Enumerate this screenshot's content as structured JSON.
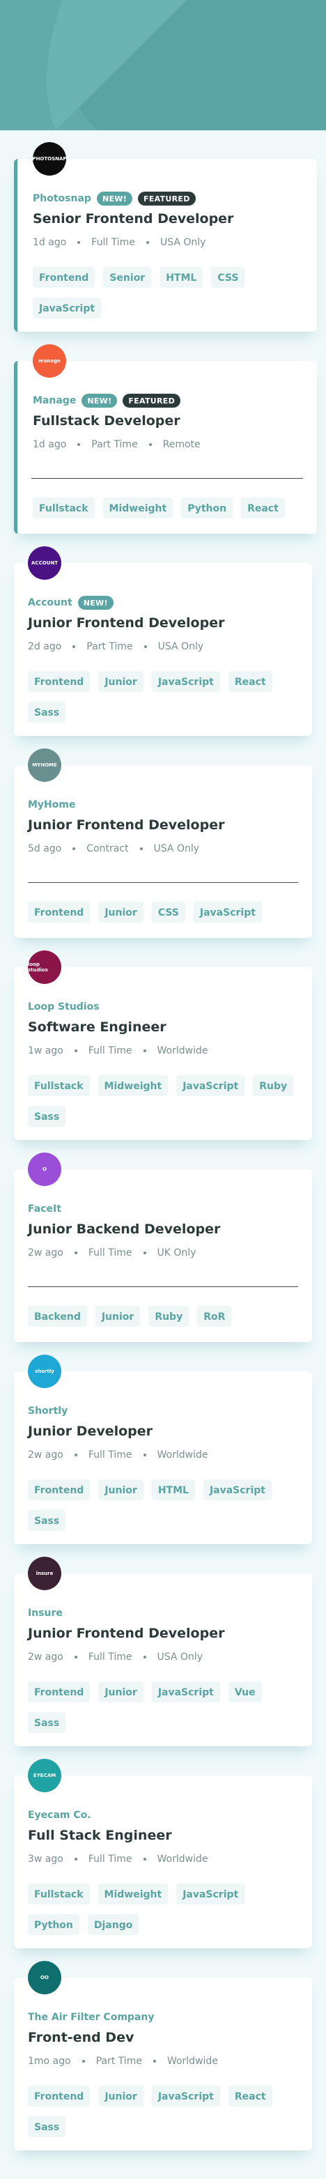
{
  "jobs": [
    {
      "company": "Photosnap",
      "logo_text": "PHOTOSNAP",
      "logo_color": "#0d0d0d",
      "new_badge": "NEW!",
      "featured_badge": "FEATURED",
      "title": "Senior Frontend Developer",
      "posted": "1d ago",
      "contract": "Full Time",
      "location": "USA Only",
      "tags": [
        "Frontend",
        "Senior",
        "HTML",
        "CSS",
        "JavaScript"
      ]
    },
    {
      "company": "Manage",
      "logo_text": "manage",
      "logo_color": "#f25f3a",
      "new_badge": "NEW!",
      "featured_badge": "FEATURED",
      "title": "Fullstack Developer",
      "posted": "1d ago",
      "contract": "Part Time",
      "location": "Remote",
      "tags": [
        "Fullstack",
        "Midweight",
        "Python",
        "React"
      ]
    },
    {
      "company": "Account",
      "logo_text": "ACCOUNT",
      "logo_color": "#4b1286",
      "new_badge": "NEW!",
      "title": "Junior Frontend Developer",
      "posted": "2d ago",
      "contract": "Part Time",
      "location": "USA Only",
      "tags": [
        "Frontend",
        "Junior",
        "JavaScript",
        "React",
        "Sass"
      ]
    },
    {
      "company": "MyHome",
      "logo_text": "MYHOME",
      "logo_color": "#6a8f8f",
      "title": "Junior Frontend Developer",
      "posted": "5d ago",
      "contract": "Contract",
      "location": "USA Only",
      "tags": [
        "Frontend",
        "Junior",
        "CSS",
        "JavaScript"
      ]
    },
    {
      "company": "Loop Studios",
      "logo_text": "loop studios",
      "logo_color": "#8b1448",
      "title": "Software Engineer",
      "posted": "1w ago",
      "contract": "Full Time",
      "location": "Worldwide",
      "tags": [
        "Fullstack",
        "Midweight",
        "JavaScript",
        "Ruby",
        "Sass"
      ]
    },
    {
      "company": "FaceIt",
      "logo_text": "O",
      "logo_color": "#9b4fd8",
      "title": "Junior Backend Developer",
      "posted": "2w ago",
      "contract": "Full Time",
      "location": "UK Only",
      "tags": [
        "Backend",
        "Junior",
        "Ruby",
        "RoR"
      ]
    },
    {
      "company": "Shortly",
      "logo_text": "shortly",
      "logo_color": "#1fa7d6",
      "title": "Junior Developer",
      "posted": "2w ago",
      "contract": "Full Time",
      "location": "Worldwide",
      "tags": [
        "Frontend",
        "Junior",
        "HTML",
        "JavaScript",
        "Sass"
      ]
    },
    {
      "company": "Insure",
      "logo_text": "insure",
      "logo_color": "#3c2333",
      "title": "Junior Frontend Developer",
      "posted": "2w ago",
      "contract": "Full Time",
      "location": "USA Only",
      "tags": [
        "Frontend",
        "Junior",
        "JavaScript",
        "Vue",
        "Sass"
      ]
    },
    {
      "company": "Eyecam Co.",
      "logo_text": "EYECAM",
      "logo_color": "#22a3a3",
      "title": "Full Stack Engineer",
      "posted": "3w ago",
      "contract": "Full Time",
      "location": "Worldwide",
      "tags": [
        "Fullstack",
        "Midweight",
        "JavaScript",
        "Python",
        "Django"
      ]
    },
    {
      "company": "The Air Filter Company",
      "logo_text": "OO",
      "logo_color": "#0f6e6e",
      "title": "Front-end Dev",
      "posted": "1mo ago",
      "contract": "Part Time",
      "location": "Worldwide",
      "tags": [
        "Frontend",
        "Junior",
        "JavaScript",
        "React",
        "Sass"
      ]
    }
  ]
}
